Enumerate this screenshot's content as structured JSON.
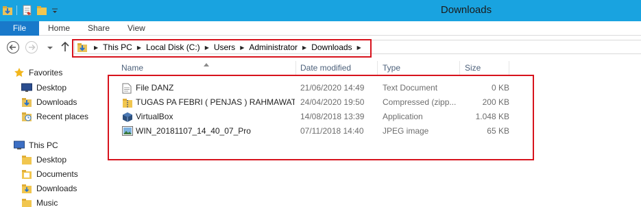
{
  "window": {
    "title": "Downloads",
    "accent_color": "#19a3e0",
    "quick_access": [
      {
        "icon": "properties-icon"
      },
      {
        "icon": "new-folder-icon"
      },
      {
        "icon": "customize-qat-icon"
      }
    ]
  },
  "ribbon": {
    "file_label": "File",
    "tabs": [
      "Home",
      "Share",
      "View"
    ]
  },
  "address": {
    "crumbs": [
      "This PC",
      "Local Disk (C:)",
      "Users",
      "Administrator",
      "Downloads"
    ]
  },
  "nav_pane": {
    "favorites_label": "Favorites",
    "favorites": [
      {
        "label": "Desktop",
        "icon": "desktop-icon"
      },
      {
        "label": "Downloads",
        "icon": "downloads-folder-icon"
      },
      {
        "label": "Recent places",
        "icon": "recent-places-icon"
      }
    ],
    "this_pc_label": "This PC",
    "this_pc": [
      {
        "label": "Desktop",
        "icon": "folder-icon"
      },
      {
        "label": "Documents",
        "icon": "folder-icon"
      },
      {
        "label": "Downloads",
        "icon": "folder-icon"
      },
      {
        "label": "Music",
        "icon": "folder-icon"
      }
    ]
  },
  "file_list": {
    "columns": {
      "name": "Name",
      "date": "Date modified",
      "type": "Type",
      "size": "Size"
    },
    "rows": [
      {
        "name": "File DANZ",
        "date": "21/06/2020 14:49",
        "type": "Text Document",
        "size": "0 KB",
        "icon": "text-file-icon"
      },
      {
        "name": "TUGAS PA FEBRI ( PENJAS ) RAHMAWAT...",
        "date": "24/04/2020 19:50",
        "type": "Compressed (zipp...",
        "size": "200 KB",
        "icon": "zip-folder-icon"
      },
      {
        "name": "VirtualBox",
        "date": "14/08/2018 13:39",
        "type": "Application",
        "size": "1.048 KB",
        "icon": "virtualbox-icon"
      },
      {
        "name": "WIN_20181107_14_40_07_Pro",
        "date": "07/11/2018 14:40",
        "type": "JPEG image",
        "size": "65 KB",
        "icon": "jpeg-image-icon"
      }
    ]
  },
  "annotations": {
    "highlight_color": "#d7121c"
  }
}
